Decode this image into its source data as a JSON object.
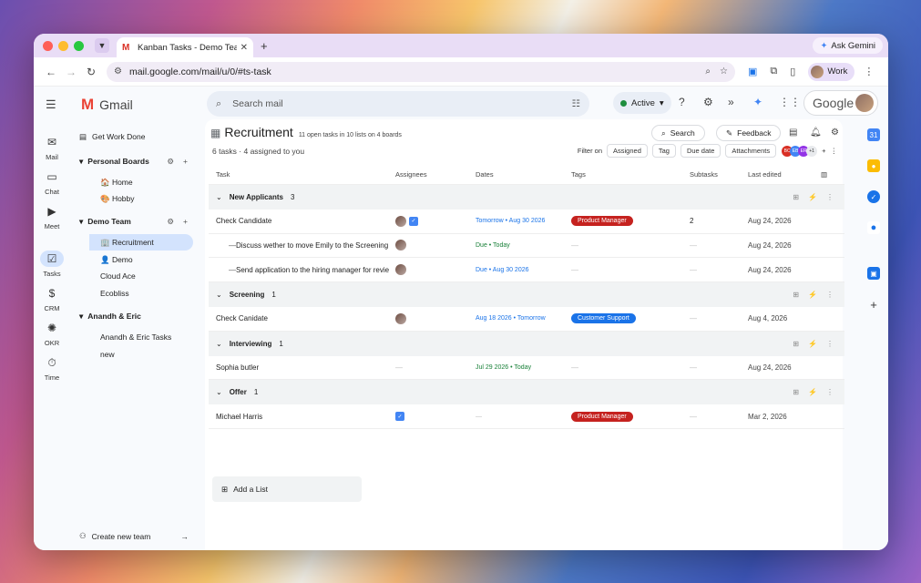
{
  "browser": {
    "tab_title": "Kanban Tasks - Demo Team - ",
    "tab_close": "✕",
    "new_tab": "+",
    "ask_gemini": "Ask Gemini",
    "url": "mail.google.com/mail/u/0/#ts-task",
    "profile": "Work"
  },
  "gmail": {
    "logo_text": "Gmail",
    "search_placeholder": "Search mail",
    "status": "Active",
    "google_pill": "Google"
  },
  "rail": [
    {
      "label": "Mail",
      "icon": "mail-icon"
    },
    {
      "label": "Chat",
      "icon": "chat-icon"
    },
    {
      "label": "Meet",
      "icon": "meet-icon"
    },
    {
      "label": "Tasks",
      "icon": "tasks-icon"
    },
    {
      "label": "CRM",
      "icon": "crm-icon"
    },
    {
      "label": "OKR",
      "icon": "okr-icon"
    },
    {
      "label": "Time",
      "icon": "time-icon"
    }
  ],
  "sidebar": {
    "get_work_done": "Get Work Done",
    "personal_boards": "Personal Boards",
    "home": "🏠 Home",
    "hobby": "🎨 Hobby",
    "demo_team": "Demo Team",
    "recruitment": "🏢 Recruitment",
    "demo": "👤 Demo",
    "cloud_ace": "Cloud Ace",
    "ecobliss": "Ecobliss",
    "anandh_eric": "Anandh & Eric",
    "anandh_eric_tasks": "Anandh & Eric Tasks",
    "new": "new",
    "create_team": "Create new team"
  },
  "board": {
    "title": "Recruitment",
    "meta": "11 open tasks in 10 lists on 4 boards",
    "subline": "6 tasks · 4 assigned to you",
    "search": "Search",
    "feedback": "Feedback",
    "filter_on": "Filter on",
    "filters": [
      "Assigned",
      "Tag",
      "Due date",
      "Attachments"
    ],
    "avatars": [
      "BC",
      "EB",
      "ER"
    ],
    "avatar_more": "+1"
  },
  "table": {
    "headers": {
      "task": "Task",
      "assignees": "Assignees",
      "dates": "Dates",
      "tags": "Tags",
      "subtasks": "Subtasks",
      "edited": "Last edited"
    },
    "groups": [
      {
        "name": "New Applicants",
        "count": "3"
      },
      {
        "name": "Screening",
        "count": "1"
      },
      {
        "name": "Interviewing",
        "count": "1"
      },
      {
        "name": "Offer",
        "count": "1"
      }
    ],
    "rows": [
      {
        "task": "Check Candidate",
        "date": "Tomorrow • Aug 30 2026",
        "tag": "Product Manager",
        "subtasks": "2",
        "edited": "Aug 24, 2026"
      },
      {
        "task": "Discuss wether to move Emily to the Screening",
        "date": "Due • Today",
        "tag": "—",
        "subtasks": "—",
        "edited": "Aug 24, 2026"
      },
      {
        "task": "Send application to the hiring manager for review",
        "date": "Due • Aug 30 2026",
        "tag": "—",
        "subtasks": "—",
        "edited": "Aug 24, 2026"
      },
      {
        "task": "Check Canidate",
        "date": "Aug 18 2026 • Tomorrow",
        "tag": "Customer Support",
        "subtasks": "—",
        "edited": "Aug 4, 2026"
      },
      {
        "task": "Sophia butler",
        "assignee_dash": "—",
        "date": "Jul 29 2026 • Today",
        "tag": "—",
        "subtasks": "—",
        "edited": "Aug 24, 2026"
      },
      {
        "task": "Michael Harris",
        "date": "—",
        "tag": "Product Manager",
        "subtasks": "—",
        "edited": "Mar 2, 2026"
      }
    ],
    "add_list": "Add a List"
  },
  "colors": {
    "pm_tag": "#c5221f",
    "cs_tag": "#1a73e8",
    "date_blue": "#1a73e8",
    "date_green": "#188038"
  }
}
